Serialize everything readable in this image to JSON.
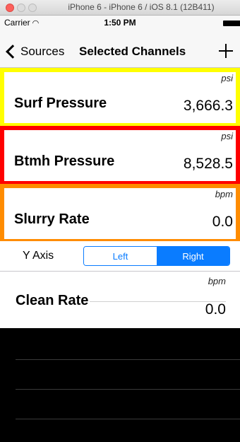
{
  "window": {
    "title": "iPhone 6 - iPhone 6 / iOS 8.1 (12B411)"
  },
  "status_bar": {
    "carrier": "Carrier",
    "time": "1:50 PM"
  },
  "nav": {
    "back_label": "Sources",
    "title": "Selected Channels"
  },
  "channels": [
    {
      "name": "Surf Pressure",
      "unit": "psi",
      "value": "3,666.3",
      "border_color": "#ffff00"
    },
    {
      "name": "Btmh Pressure",
      "unit": "psi",
      "value": "8,528.5",
      "border_color": "#ff0000"
    },
    {
      "name": "Slurry Rate",
      "unit": "bpm",
      "value": "0.0",
      "border_color": "#ff8c00"
    }
  ],
  "y_axis": {
    "label": "Y Axis",
    "options": [
      "Left",
      "Right"
    ],
    "selected": "Right"
  },
  "extra_channel": {
    "name": "Clean Rate",
    "unit": "bpm",
    "value": "0.0"
  },
  "colors": {
    "accent": "#0a7cff"
  }
}
